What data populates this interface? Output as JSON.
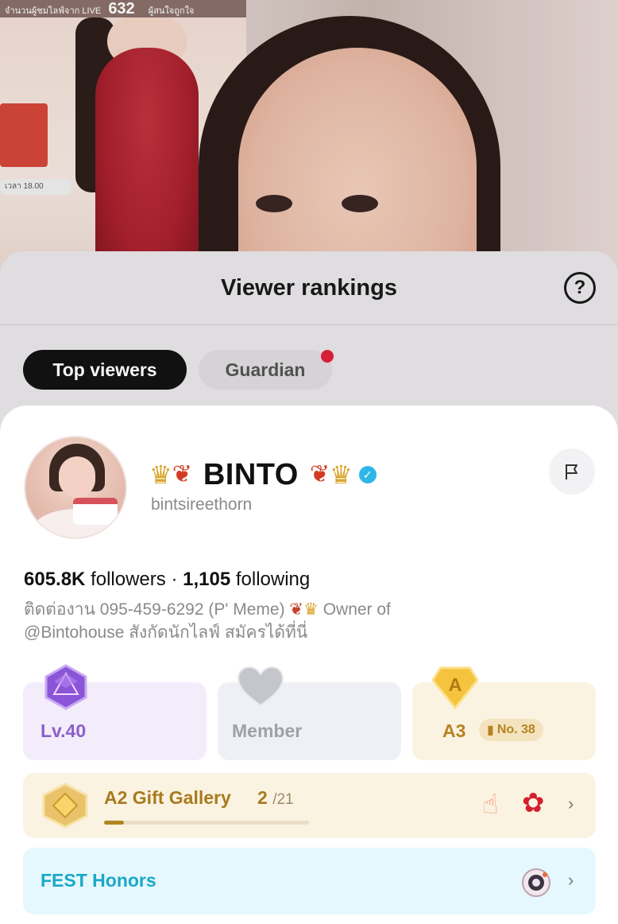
{
  "video": {
    "banner_text": "จำนวนผู้ชมไลฟ์จาก LIVE",
    "viewer_count": "632",
    "banner_tag": "ผู้สนใจถูกใจ",
    "time_tag": "เวลา 18.00"
  },
  "rankings": {
    "title": "Viewer rankings",
    "help_glyph": "?",
    "tabs": [
      {
        "label": "Top viewers",
        "active": true
      },
      {
        "label": "Guardian",
        "active": false,
        "has_notification": true
      }
    ]
  },
  "profile": {
    "name": "BINTO",
    "handle": "bintsireethorn",
    "verified": true,
    "followers": "605.8K",
    "followers_label": "followers",
    "separator": "·",
    "following": "1,105",
    "following_label": "following",
    "bio_line1_a": "ติดต่องาน 095-459-6292 (P' Meme)",
    "bio_line1_b": "Owner of",
    "bio_line2": "@Bintohouse  สังกัดนักไลฟ์ สมัครได้ที่นี่",
    "icons": {
      "prefix": [
        "crown-icon",
        "maple-leaf-icon"
      ],
      "suffix": [
        "maple-leaf-icon",
        "crown-icon"
      ],
      "flag": "flag-icon"
    }
  },
  "badges": {
    "level": {
      "label": "Lv.40",
      "icon": "purple-gem-icon",
      "color": "#8b61c9"
    },
    "member": {
      "label": "Member",
      "icon": "heart-icon",
      "color": "#9fa1aa"
    },
    "rank": {
      "label": "A3",
      "icon": "gold-shield-a-icon",
      "pill_label": "No. 38",
      "color": "#b68322"
    }
  },
  "gift_gallery": {
    "title": "A2 Gift Gallery",
    "count": "2",
    "total": "/21",
    "progress": 0.095,
    "gifts": [
      "finger-heart-icon",
      "rose-icon"
    ]
  },
  "fest": {
    "title": "FEST Honors",
    "icon": "fest-medal-icon"
  },
  "colors": {
    "accent_gold": "#b68322",
    "accent_purple": "#8b61c9",
    "accent_cyan": "#1aa8c8",
    "verified_blue": "#2fb6e8",
    "notification_red": "#e0203a"
  }
}
